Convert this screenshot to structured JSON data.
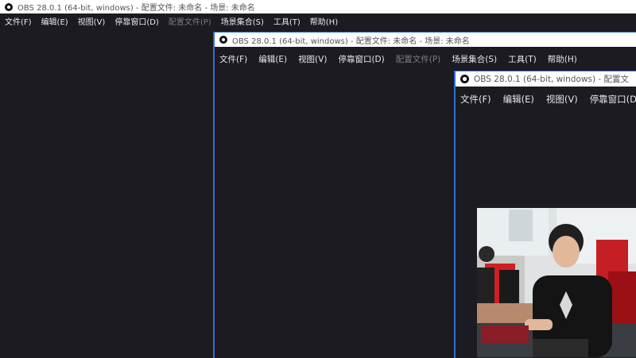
{
  "title": "OBS 28.0.1 (64-bit, windows) - 配置文件: 未命名 - 场景: 未命名",
  "title_truncated_2": "OBS 28.0.1 (64-bit, windows) - 配置文件: 未命名 - 场景: 未命名",
  "title_truncated_3": "OBS 28.0.1 (64-bit, windows) - 配置文",
  "menu": [
    {
      "label": "文件(F)"
    },
    {
      "label": "编辑(E)"
    },
    {
      "label": "视图(V)"
    },
    {
      "label": "停靠窗口(D)"
    },
    {
      "label": "配置文件(P)",
      "disabled": true
    },
    {
      "label": "场景集合(S)"
    },
    {
      "label": "工具(T)"
    },
    {
      "label": "帮助(H)"
    }
  ],
  "colors": {
    "background": "#1c1b22",
    "titlebar": "#ffffff",
    "nested_window_border": "#2f6fd0"
  },
  "icons": {
    "logo": "obs-logo-icon"
  },
  "preview": {
    "content": "webcam-feed"
  }
}
